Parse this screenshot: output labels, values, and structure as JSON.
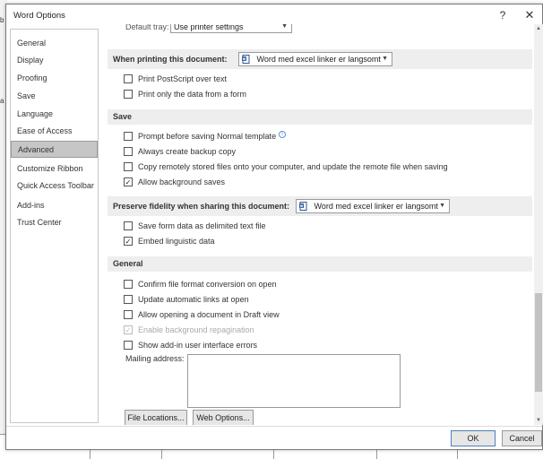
{
  "background": {
    "left_marks": [
      "b",
      "a"
    ]
  },
  "dialog": {
    "title": "Word Options",
    "help_glyph": "?",
    "close_glyph": "✕"
  },
  "sidebar": {
    "items": [
      {
        "label": "General"
      },
      {
        "label": "Display"
      },
      {
        "label": "Proofing"
      },
      {
        "label": "Save"
      },
      {
        "label": "Language"
      },
      {
        "label": "Ease of Access"
      },
      {
        "label": "Advanced",
        "selected": true
      },
      {
        "label": "Customize Ribbon"
      },
      {
        "label": "Quick Access Toolbar"
      },
      {
        "label": "Add-ins"
      },
      {
        "label": "Trust Center"
      }
    ]
  },
  "main": {
    "default_tray_label": "Default tray:",
    "default_tray_value": "Use printer settings",
    "printing": {
      "header": "When printing this document:",
      "doc_select": "Word med excel linker er langsomt",
      "options": [
        {
          "label": "Print PostScript over text",
          "checked": false
        },
        {
          "label": "Print only the data from a form",
          "checked": false
        }
      ]
    },
    "save": {
      "header": "Save",
      "options": [
        {
          "label": "Prompt before saving Normal template",
          "checked": false,
          "info": true
        },
        {
          "label": "Always create backup copy",
          "checked": false
        },
        {
          "label": "Copy remotely stored files onto your computer, and update the remote file when saving",
          "checked": false
        },
        {
          "label": "Allow background saves",
          "checked": true
        }
      ]
    },
    "fidelity": {
      "header": "Preserve fidelity when sharing this document:",
      "doc_select": "Word med excel linker er langsomt",
      "options": [
        {
          "label": "Save form data as delimited text file",
          "checked": false
        },
        {
          "label": "Embed linguistic data",
          "checked": true
        }
      ]
    },
    "general": {
      "header": "General",
      "options": [
        {
          "label": "Confirm file format conversion on open",
          "checked": false
        },
        {
          "label": "Update automatic links at open",
          "checked": false
        },
        {
          "label": "Allow opening a document in Draft view",
          "checked": false
        },
        {
          "label": "Enable background repagination",
          "checked": true,
          "disabled": true
        },
        {
          "label": "Show add-in user interface errors",
          "checked": false
        }
      ],
      "mailing_address_label": "Mailing address:",
      "mailing_address_value": "",
      "file_locations_button": "File Locations...",
      "web_options_button": "Web Options..."
    }
  },
  "footer": {
    "ok_label": "OK",
    "cancel_label": "Cancel"
  },
  "colors": {
    "selected_sidebar": "#c6c6c6",
    "section_header_bg": "#eeeeee",
    "ok_border": "#4a7fc0",
    "info_icon": "#5b8fd6"
  },
  "icons": {
    "check_glyph": "✓",
    "dropdown_glyph": "▼",
    "info_glyph": "i"
  }
}
